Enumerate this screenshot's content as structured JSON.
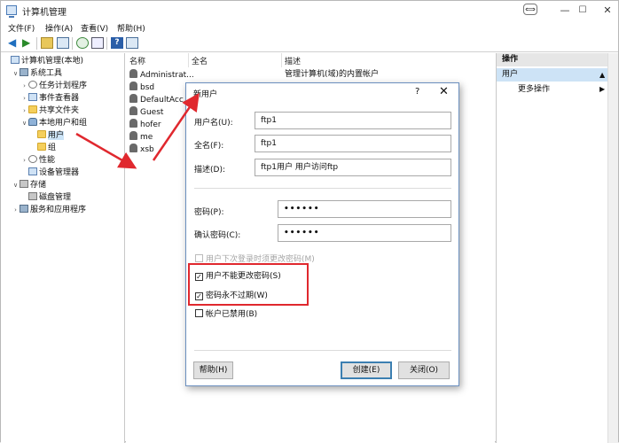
{
  "window": {
    "title": "计算机管理"
  },
  "menu": [
    "文件(F)",
    "操作(A)",
    "查看(V)",
    "帮助(H)"
  ],
  "tree": [
    {
      "label": "计算机管理(本地)",
      "icon": "computer-icon",
      "indent": 0,
      "twisty": ""
    },
    {
      "label": "系统工具",
      "icon": "tools-icon",
      "indent": 1,
      "twisty": "∨"
    },
    {
      "label": "任务计划程序",
      "icon": "clock-icon",
      "indent": 2,
      "twisty": "›"
    },
    {
      "label": "事件查看器",
      "icon": "event-viewer-icon",
      "indent": 2,
      "twisty": "›"
    },
    {
      "label": "共享文件夹",
      "icon": "shared-folder-icon",
      "indent": 2,
      "twisty": "›"
    },
    {
      "label": "本地用户和组",
      "icon": "users-icon",
      "indent": 2,
      "twisty": "∨"
    },
    {
      "label": "用户",
      "icon": "folder-icon",
      "indent": 3,
      "twisty": "",
      "selected": true
    },
    {
      "label": "组",
      "icon": "folder-icon",
      "indent": 3,
      "twisty": ""
    },
    {
      "label": "性能",
      "icon": "performance-icon",
      "indent": 2,
      "twisty": "›"
    },
    {
      "label": "设备管理器",
      "icon": "device-manager-icon",
      "indent": 2,
      "twisty": ""
    },
    {
      "label": "存储",
      "icon": "storage-icon",
      "indent": 1,
      "twisty": "∨"
    },
    {
      "label": "磁盘管理",
      "icon": "disk-icon",
      "indent": 2,
      "twisty": ""
    },
    {
      "label": "服务和应用程序",
      "icon": "services-icon",
      "indent": 1,
      "twisty": "›"
    }
  ],
  "columns": [
    "名称",
    "全名",
    "描述"
  ],
  "users": [
    {
      "name": "Administrat...",
      "description": "管理计算机(域)的内置帐户"
    },
    {
      "name": "bsd",
      "description": ""
    },
    {
      "name": "DefaultAcc...",
      "description": ""
    },
    {
      "name": "Guest",
      "description": ""
    },
    {
      "name": "hofer",
      "description": ""
    },
    {
      "name": "me",
      "description": ""
    },
    {
      "name": "xsb",
      "description": ""
    }
  ],
  "actions": {
    "header": "操作",
    "section": "用户",
    "more": "更多操作"
  },
  "dialog": {
    "title": "新用户",
    "help_glyph": "?",
    "close_glyph": "✕",
    "username_label": "用户名(U):",
    "username_value": "ftp1",
    "fullname_label": "全名(F):",
    "fullname_value": "ftp1",
    "description_label": "描述(D):",
    "description_value": "ftp1用户 用户访问ftp",
    "password_label": "密码(P):",
    "password_value": "••••••",
    "confirm_label": "确认密码(C):",
    "confirm_value": "••••••",
    "checkboxes": [
      {
        "label": "用户下次登录时须更改密码(M)",
        "checked": false,
        "disabled": true
      },
      {
        "label": "用户不能更改密码(S)",
        "checked": true,
        "disabled": false
      },
      {
        "label": "密码永不过期(W)",
        "checked": true,
        "disabled": false
      },
      {
        "label": "帐户已禁用(B)",
        "checked": false,
        "disabled": false
      }
    ],
    "help_button": "帮助(H)",
    "create_button": "创建(E)",
    "close_button": "关闭(O)"
  },
  "colors": {
    "highlight": "#e0282e",
    "selection": "#cce4f7",
    "accent": "#3c7fb1"
  }
}
